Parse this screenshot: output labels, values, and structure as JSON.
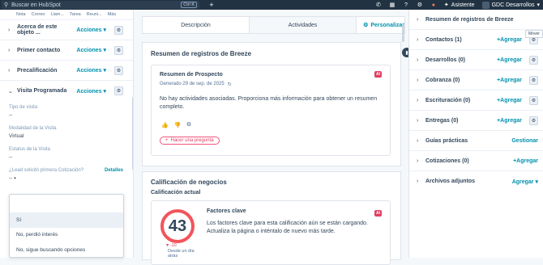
{
  "topbar": {
    "search_placeholder": "Buscar en HubSpot",
    "shortcut": "Ctrl K",
    "assistant_label": "Asistente",
    "account_label": "GDC Desarrollos"
  },
  "left_panel": {
    "quick_actions": [
      "Nota",
      "Correo",
      "Llam...",
      "Tarea",
      "Reuni...",
      "Más"
    ],
    "sections": [
      {
        "title": "Acerca de este objeto ...",
        "actions": "Acciones"
      },
      {
        "title": "Primer contacto",
        "actions": "Acciones"
      },
      {
        "title": "Precalificación",
        "actions": "Acciones"
      },
      {
        "title": "Visita Programada",
        "actions": "Acciones"
      }
    ],
    "properties": [
      {
        "label": "Tipo de visita",
        "value": "--"
      },
      {
        "label": "Modalidad de la Visita",
        "value": "Virtual"
      },
      {
        "label": "Estatus de la Visita",
        "value": "--"
      }
    ],
    "question_label": "¿Lead solicitó primera Cotización?",
    "details_link": "Detalles",
    "question_value": "--",
    "dropdown_options": [
      "Sí",
      "No, perdió interés",
      "No, sigue buscando opciones"
    ]
  },
  "center": {
    "tabs": [
      "Descripción",
      "Actividades",
      "Personalizar"
    ],
    "breeze_card": {
      "title": "Resumen de registros de Breeze",
      "inner_title": "Resumen de Prospecto",
      "ai_badge": "AI",
      "generated": "Generado 29 de sep. de 2025",
      "body": "No hay actividades asociadas. Proporciona más información para obtener un resumen completo.",
      "ask_button": "Hacer una pregunta"
    },
    "score_card": {
      "title": "Calificación de negocios",
      "subtitle": "Calificación actual",
      "score": "43",
      "delta": "-10",
      "delta_caption": "Desde un día atrás",
      "factors_title": "Factores clave",
      "ai_badge": "AI",
      "factors_body": "Los factores clave para esta calificación aún se están cargando. Actualiza la página o inténtalo de nuevo más tarde."
    }
  },
  "right_panel": {
    "tooltip": "Mover",
    "header": "Resumen de registros de Breeze",
    "rows": [
      {
        "title": "Contactos (1)",
        "action": "+Agregar"
      },
      {
        "title": "Desarrollos (0)",
        "action": "+Agregar"
      },
      {
        "title": "Cobranza (0)",
        "action": "+Agregar"
      },
      {
        "title": "Escrituración (0)",
        "action": "+Agregar"
      },
      {
        "title": "Entregas (0)",
        "action": "+Agregar"
      },
      {
        "title": "Guías prácticas",
        "action": "Gestionar"
      },
      {
        "title": "Cotizaciones (0)",
        "action": "+Agregar"
      },
      {
        "title": "Archivos adjuntos",
        "action": "Agregar"
      }
    ]
  },
  "colors": {
    "topbar": "#213343",
    "link": "#0091ae",
    "accent": "#e03e62",
    "score_ring": "#f2545b"
  }
}
